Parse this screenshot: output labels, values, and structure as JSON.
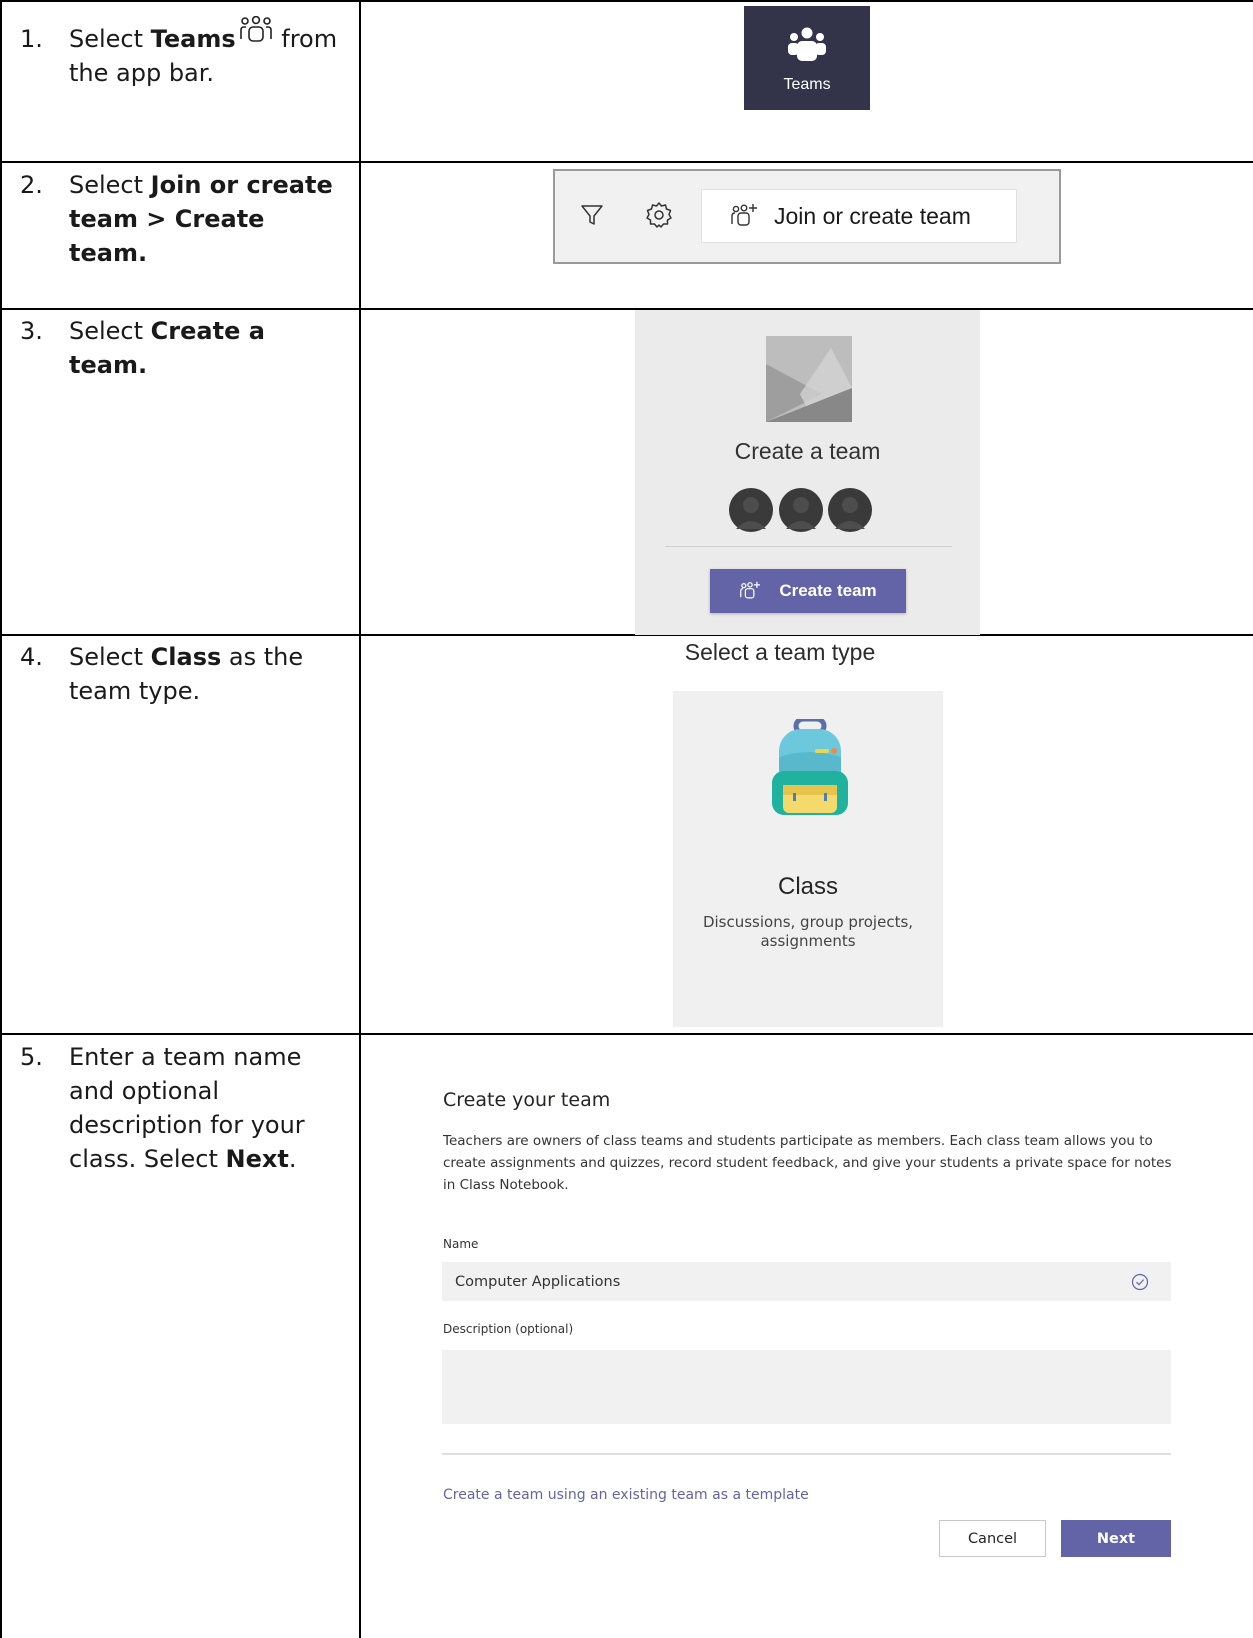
{
  "steps": [
    {
      "num": "1.",
      "pre": "Select ",
      "bold": "Teams",
      "post": " from the app bar."
    },
    {
      "num": "2.",
      "pre": "Select ",
      "bold": "Join or create team > Create team.",
      "post": ""
    },
    {
      "num": "3.",
      "pre": "Select ",
      "bold": "Create a team.",
      "post": ""
    },
    {
      "num": "4.",
      "pre": "Select ",
      "bold": "Class",
      "post": " as the team type."
    },
    {
      "num": "5.",
      "pre": "Enter a team name and optional description for your class. Select ",
      "bold": "Next",
      "post": "."
    }
  ],
  "app_bar": {
    "teams_label": "Teams",
    "bg_color": "#33344a"
  },
  "toolbar": {
    "join_label": "Join or create team",
    "icons": [
      "filter-icon",
      "gear-icon",
      "add-people-icon"
    ]
  },
  "create_card": {
    "title": "Create a team",
    "button_label": "Create team",
    "accent": "#6264a7"
  },
  "team_type": {
    "title": "Select a team type",
    "option_name": "Class",
    "option_desc": "Discussions, group projects, assignments"
  },
  "create_form": {
    "heading": "Create your team",
    "intro": "Teachers are owners of class teams and students participate as members. Each class team allows you to create assignments and quizzes, record student feedback, and give your students a private space for notes in Class Notebook.",
    "name_label": "Name",
    "name_value": "Computer Applications",
    "description_label": "Description (optional)",
    "description_value": "",
    "template_link": "Create a team using an existing team as a template",
    "cancel_label": "Cancel",
    "next_label": "Next"
  }
}
